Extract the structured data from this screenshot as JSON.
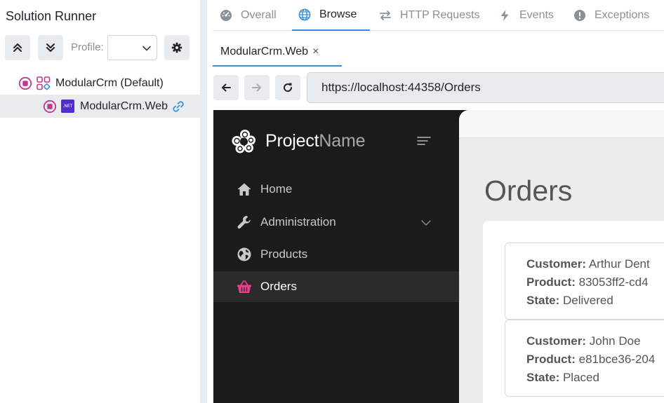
{
  "left_panel": {
    "title": "Solution Runner",
    "toolbar": {
      "collapse_all_icon": "double-chevron-up-icon",
      "expand_all_icon": "double-chevron-down-icon",
      "profile_label": "Profile:",
      "profile_value": "",
      "settings_icon": "gear-icon"
    },
    "tree": [
      {
        "label": "ModularCrm (Default)",
        "icon": "solution-icon",
        "status_icon": "stop-icon",
        "selected": false
      },
      {
        "label": "ModularCrm.Web",
        "icon": "dotnet-icon",
        "badge": ".NET",
        "status_icon": "stop-icon",
        "trailing_icon": "link-icon",
        "selected": true
      }
    ]
  },
  "main_tabs": [
    {
      "label": "Overall",
      "icon": "dashboard-icon",
      "active": false
    },
    {
      "label": "Browse",
      "icon": "globe-icon",
      "active": true
    },
    {
      "label": "HTTP Requests",
      "icon": "arrows-exchange-icon",
      "active": false
    },
    {
      "label": "Events",
      "icon": "bolt-icon",
      "active": false
    },
    {
      "label": "Exceptions",
      "icon": "exclamation-circle-icon",
      "active": false
    }
  ],
  "browser": {
    "tab_label": "ModularCrm.Web",
    "tab_close": "×",
    "url": "https://localhost:44358/Orders"
  },
  "webapp": {
    "brand_primary": "Project",
    "brand_secondary": "Name",
    "menu": [
      {
        "label": "Home",
        "icon": "home-icon",
        "active": false
      },
      {
        "label": "Administration",
        "icon": "wrench-icon",
        "active": false,
        "has_submenu": true
      },
      {
        "label": "Products",
        "icon": "globe-icon",
        "active": false
      },
      {
        "label": "Orders",
        "icon": "basket-icon",
        "active": true
      }
    ],
    "page_title": "Orders",
    "labels": {
      "customer": "Customer:",
      "product": "Product:",
      "state": "State:"
    },
    "orders": [
      {
        "customer": "Arthur Dent",
        "product": "83053ff2-cd4",
        "state": "Delivered"
      },
      {
        "customer": "John Doe",
        "product": "e81bce36-204",
        "state": "Placed"
      }
    ]
  },
  "colors": {
    "accent_blue": "#3b8fd4",
    "stop_magenta": "#c0398f",
    "sidebar_dark": "#1b1b1b",
    "orders_active_pink": "#e83e8c",
    "dotnet_purple": "#512bd4"
  }
}
